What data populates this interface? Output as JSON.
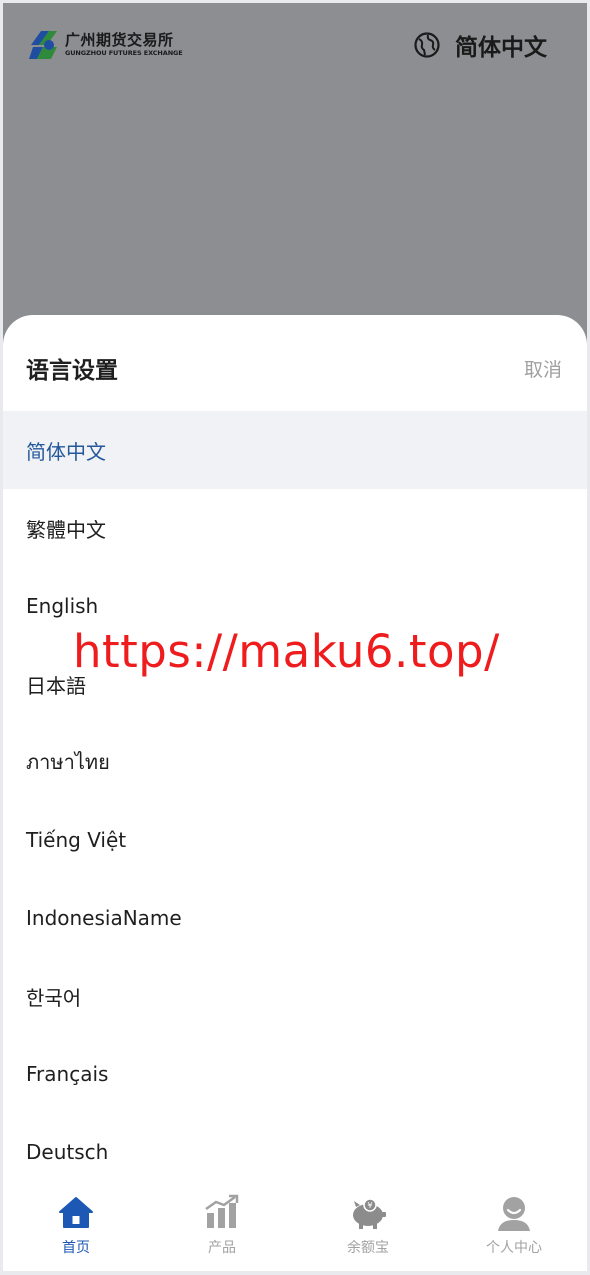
{
  "header": {
    "logo_cn": "广州期货交易所",
    "logo_en": "GUNGZHOU FUTURES EXCHANGE",
    "current_language": "简体中文"
  },
  "sheet": {
    "title": "语言设置",
    "cancel_label": "取消",
    "languages": [
      {
        "label": "简体中文",
        "selected": true
      },
      {
        "label": "繁體中文",
        "selected": false
      },
      {
        "label": "English",
        "selected": false
      },
      {
        "label": "日本語",
        "selected": false
      },
      {
        "label": "ภาษาไทย",
        "selected": false
      },
      {
        "label": "Tiếng Việt",
        "selected": false
      },
      {
        "label": "IndonesiaName",
        "selected": false
      },
      {
        "label": "한국어",
        "selected": false
      },
      {
        "label": "Français",
        "selected": false
      },
      {
        "label": "Deutsch",
        "selected": false
      }
    ]
  },
  "watermark": "https://maku6.top/",
  "bottom_nav": [
    {
      "label": "首页",
      "icon": "home-icon",
      "active": true
    },
    {
      "label": "产品",
      "icon": "chart-icon",
      "active": false
    },
    {
      "label": "余额宝",
      "icon": "piggy-bank-icon",
      "active": false
    },
    {
      "label": "个人中心",
      "icon": "user-icon",
      "active": false
    }
  ],
  "colors": {
    "accent": "#1e58b5",
    "selected_text": "#25589a",
    "inactive": "#a2a2a2",
    "watermark": "#ee1c1c",
    "overlay": "#8d8e92"
  }
}
